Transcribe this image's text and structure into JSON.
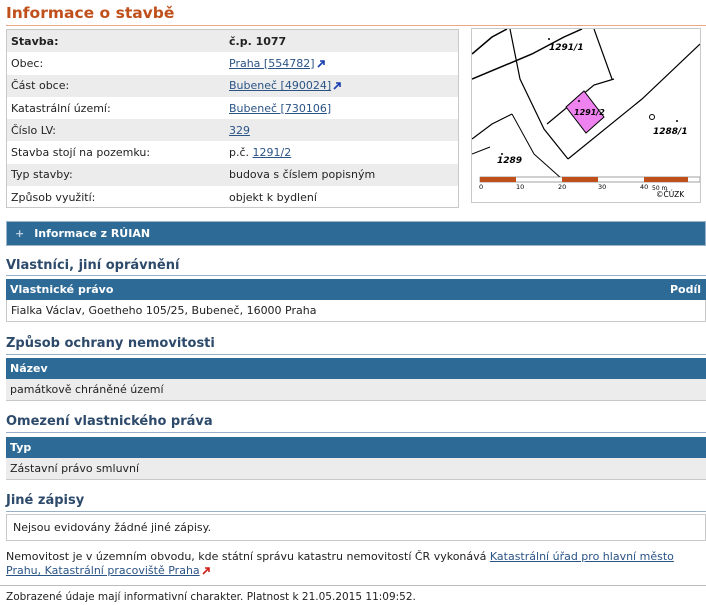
{
  "title": "Informace o stavbě",
  "info_rows": [
    {
      "key": "Stavba:",
      "value": "č.p. 1077",
      "link": false
    },
    {
      "key": "Obec:",
      "value": "Praha [554782]",
      "link": true,
      "ext": true
    },
    {
      "key": "Část obce:",
      "value": "Bubeneč [490024]",
      "link": true,
      "ext": true
    },
    {
      "key": "Katastrální území:",
      "value": "Bubeneč [730106]",
      "link": true
    },
    {
      "key": "Číslo LV:",
      "value": "329",
      "link": true
    },
    {
      "key": "Stavba stojí na pozemku:",
      "prefix": "p.č.",
      "value": "1291/2",
      "link": true
    },
    {
      "key": "Typ stavby:",
      "value": "budova s číslem popisným",
      "link": false
    },
    {
      "key": "Způsob využití:",
      "value": "objekt k bydlení",
      "link": false
    }
  ],
  "map": {
    "parcels": [
      "1291/1",
      "1291/2",
      "1288/1",
      "1289"
    ],
    "scale": [
      "0",
      "10",
      "20",
      "30",
      "40",
      "50 m"
    ],
    "credit": "©ČÚZK"
  },
  "ruian": {
    "plus": "+",
    "label": "Informace z RÚIAN"
  },
  "owners": {
    "title": "Vlastníci, jiní oprávnění",
    "col1": "Vlastnické právo",
    "col2": "Podíl",
    "rows": [
      "Fialka Václav, Goetheho 105/25, Bubeneč, 16000 Praha"
    ]
  },
  "protection": {
    "title": "Způsob ochrany nemovitosti",
    "col": "Název",
    "rows": [
      "památkově chráněné území"
    ]
  },
  "restrictions": {
    "title": "Omezení vlastnického práva",
    "col": "Typ",
    "rows": [
      "Zástavní právo smluvní"
    ]
  },
  "other": {
    "title": "Jiné zápisy",
    "text": "Nejsou evidovány žádné jiné zápisy."
  },
  "note": {
    "text": "Nemovitost je v územním obvodu, kde státní správu katastru nemovitostí ČR vykonává",
    "link": "Katastrální úřad pro hlavní město Prahu, Katastrální pracoviště Praha"
  },
  "footer": "Zobrazené údaje mají informativní charakter. Platnost k 21.05.2015 11:09:52.",
  "colors": {
    "title": "#c0501b",
    "header": "#2d6a96",
    "link": "#2b5486",
    "highlight": "#ee82ee"
  }
}
